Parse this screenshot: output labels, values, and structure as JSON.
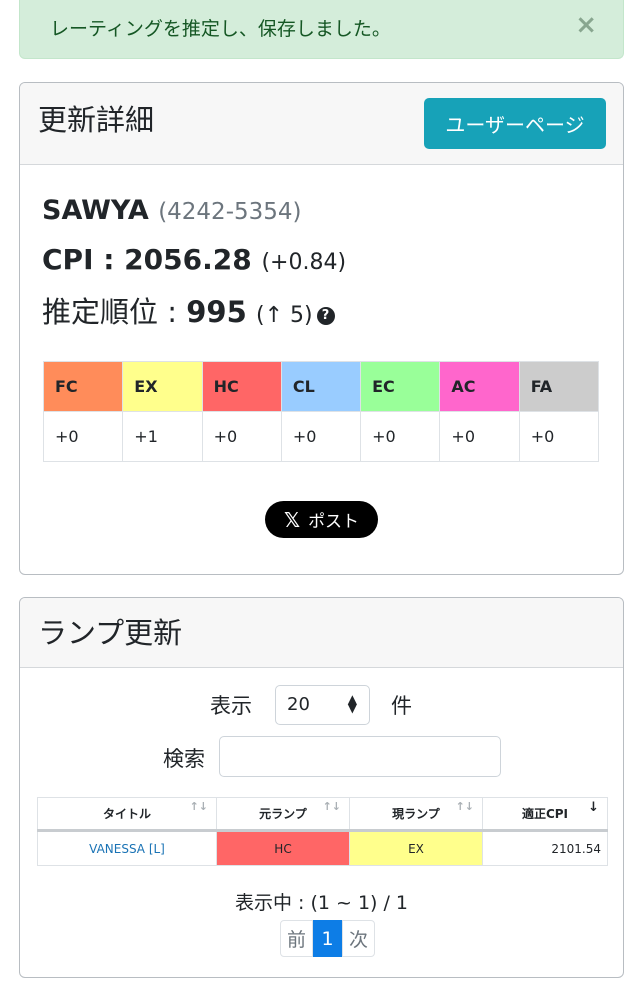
{
  "alert": {
    "message": "レーティングを推定し、保存しました。",
    "close": "×"
  },
  "details": {
    "header_title": "更新詳細",
    "user_page_button": "ユーザーページ",
    "user_name": "SAWYA",
    "user_id": "(4242-5354)",
    "cpi_label": "CPI : 2056.28",
    "cpi_delta": "(+0.84)",
    "rank_label": "推定順位 : ",
    "rank_value": "995",
    "rank_change": "(↑ 5)",
    "help_icon": "question-circle-icon",
    "lamps": [
      {
        "name": "FC",
        "value": "+0",
        "color": "#ff8c5a"
      },
      {
        "name": "EX",
        "value": "+1",
        "color": "#ffff8c"
      },
      {
        "name": "HC",
        "value": "+0",
        "color": "#ff6666"
      },
      {
        "name": "CL",
        "value": "+0",
        "color": "#99ccff"
      },
      {
        "name": "EC",
        "value": "+0",
        "color": "#99ff99"
      },
      {
        "name": "AC",
        "value": "+0",
        "color": "#ff66cc"
      },
      {
        "name": "FA",
        "value": "+0",
        "color": "#cccccc"
      }
    ],
    "post_button": "ポスト",
    "post_icon": "x-logo-icon"
  },
  "lamp_update": {
    "header_title": "ランプ更新",
    "show_label": "表示",
    "page_size": "20",
    "unit_label": "件",
    "search_label": "検索",
    "search_value": "",
    "columns": [
      "タイトル",
      "元ランプ",
      "現ランプ",
      "適正CPI"
    ],
    "rows": [
      {
        "title": "VANESSA [L]",
        "old_lamp": "HC",
        "old_color": "#ff6666",
        "new_lamp": "EX",
        "new_color": "#ffff8c",
        "cpi": "2101.54"
      }
    ],
    "showing": "表示中 : (1 ~ 1) / 1",
    "pager": {
      "prev": "前",
      "current": "1",
      "next": "次"
    }
  }
}
